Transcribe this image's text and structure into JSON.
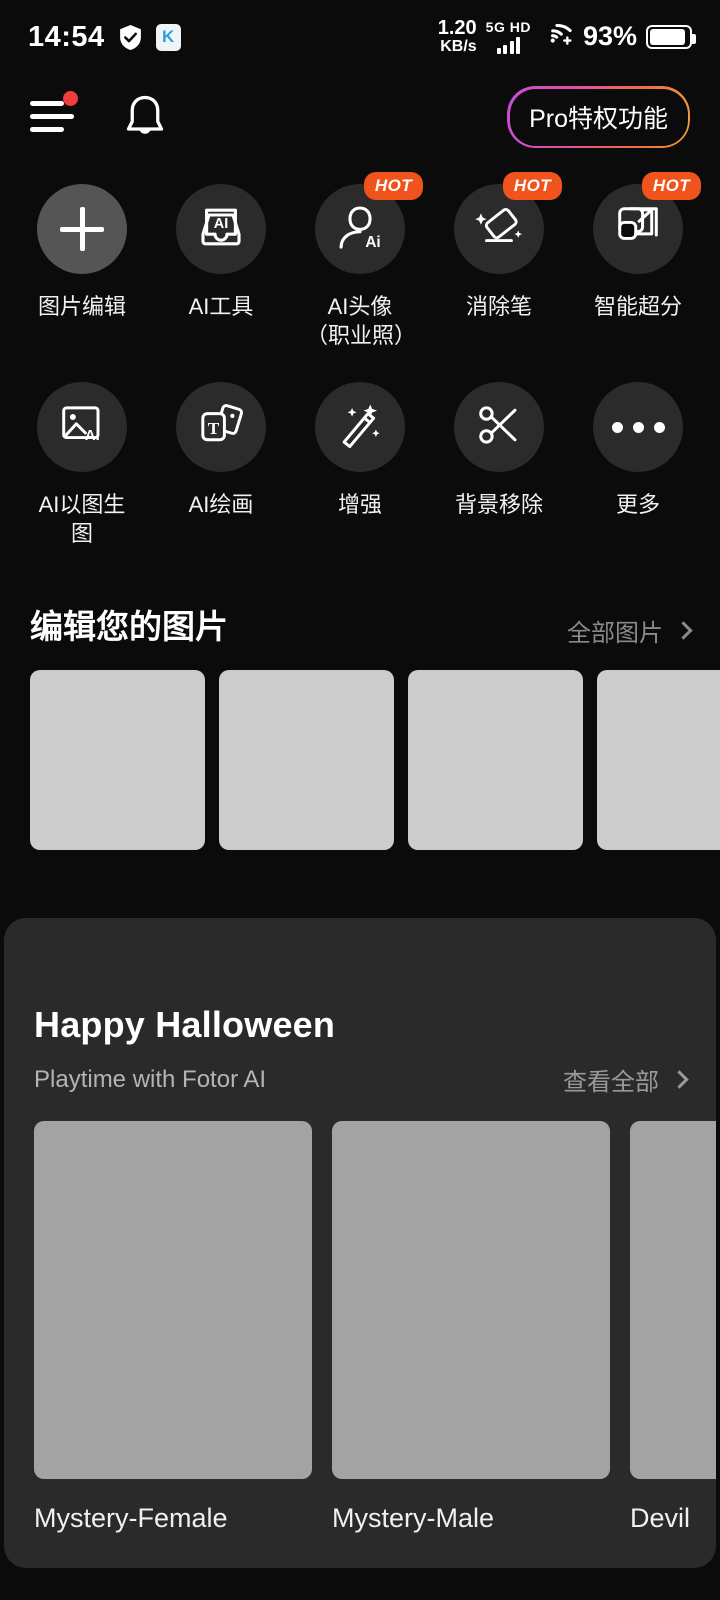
{
  "status_bar": {
    "time": "14:54",
    "shield_icon": "shield-check-icon",
    "app_icon_letter": "K",
    "net_speed_value": "1.20",
    "net_speed_unit": "KB/s",
    "network_tag": "5G HD",
    "signal_icon": "signal-bars-icon",
    "wifi_icon": "wifi-icon",
    "battery_percent": "93%",
    "battery_icon": "battery-icon"
  },
  "header": {
    "menu_icon": "hamburger-menu-icon",
    "notification_icon": "bell-icon",
    "badge_icon": "red-dot-badge",
    "pro_label": "Pro特权功能",
    "pro_gradient_start": "#c64ddb",
    "pro_gradient_end": "#f0a03a"
  },
  "tools": {
    "hot_badge_label": "HOT",
    "hot_badge_color": "#f0531c",
    "row1": [
      {
        "label": "图片编辑",
        "icon": "plus-icon",
        "hot": false,
        "highlight": true
      },
      {
        "label": "AI工具",
        "icon": "ai-inbox-icon",
        "hot": false,
        "highlight": false
      },
      {
        "label": "AI头像（职业照）",
        "icon": "ai-avatar-person-icon",
        "hot": true,
        "highlight": false
      },
      {
        "label": "消除笔",
        "icon": "magic-eraser-icon",
        "hot": true,
        "highlight": false
      },
      {
        "label": "智能超分",
        "icon": "upscale-expand-icon",
        "hot": true,
        "highlight": false
      }
    ],
    "row2": [
      {
        "label": "AI以图生图",
        "icon": "ai-image-to-image-icon",
        "hot": false,
        "highlight": false
      },
      {
        "label": "AI绘画",
        "icon": "ai-text-to-art-icon",
        "hot": false,
        "highlight": false
      },
      {
        "label": "增强",
        "icon": "magic-wand-icon",
        "hot": false,
        "highlight": false
      },
      {
        "label": "背景移除",
        "icon": "scissors-icon",
        "hot": false,
        "highlight": false
      },
      {
        "label": "更多",
        "icon": "ellipsis-icon",
        "hot": false,
        "highlight": false
      }
    ]
  },
  "edit_photos": {
    "title": "编辑您的图片",
    "more_label": "全部图片",
    "more_icon": "chevron-right-icon",
    "thumbnails": [
      {
        "name": "photo-thumbnail-1"
      },
      {
        "name": "photo-thumbnail-2"
      },
      {
        "name": "photo-thumbnail-3"
      },
      {
        "name": "photo-thumbnail-4"
      }
    ]
  },
  "halloween": {
    "title": "Happy Halloween",
    "subtitle": "Playtime with Fotor AI",
    "more_label": "查看全部",
    "more_icon": "chevron-right-icon",
    "items": [
      {
        "name": "Mystery-Female"
      },
      {
        "name": "Mystery-Male"
      },
      {
        "name": "Devil"
      }
    ]
  },
  "watermark": "·"
}
